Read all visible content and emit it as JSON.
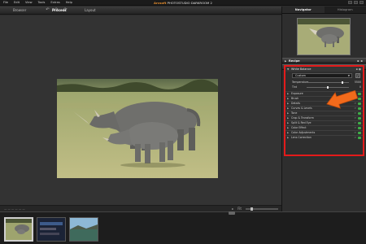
{
  "menu": [
    "File",
    "Edit",
    "View",
    "Tools",
    "Extras",
    "Help"
  ],
  "app_title": {
    "brand": "Arcsoft",
    "product": "PHOTOSTUDIO DARKROOM 2"
  },
  "modes": {
    "browser": "Browser",
    "process": "Process",
    "layout": "Layout"
  },
  "right_tabs": {
    "navigator": "Navigator",
    "histogram": "Histogram"
  },
  "recipe": {
    "title": "Recipe"
  },
  "adjustments": {
    "title": "Adjustments",
    "white_balance": {
      "title": "White Balance",
      "preset": "Custom",
      "temperature_label": "Temperature",
      "temperature_value": "5500",
      "temperature_level": 0.85,
      "tint_label": "Tint",
      "tint_value": "0",
      "tint_level": 0.5
    },
    "tools": [
      "Exposure",
      "Brush",
      "Details",
      "Curves & Levels",
      "Tone",
      "Crop & Transform",
      "Split & Red Eye",
      "Color Effect",
      "Color Adjustments",
      "Lens Correction"
    ]
  },
  "viewer_bottom": {
    "left": "— — — — — —",
    "fit": "Fit"
  },
  "icons": {
    "undo": "undo-icon",
    "redo": "redo-icon",
    "rotate": "rotate-icon",
    "picker": "eyedropper-icon"
  },
  "colors": {
    "highlight": "#e31b1b",
    "arrow": "#f26a1b",
    "toggle_on": "#3fae49",
    "brand": "#e08a2c"
  }
}
